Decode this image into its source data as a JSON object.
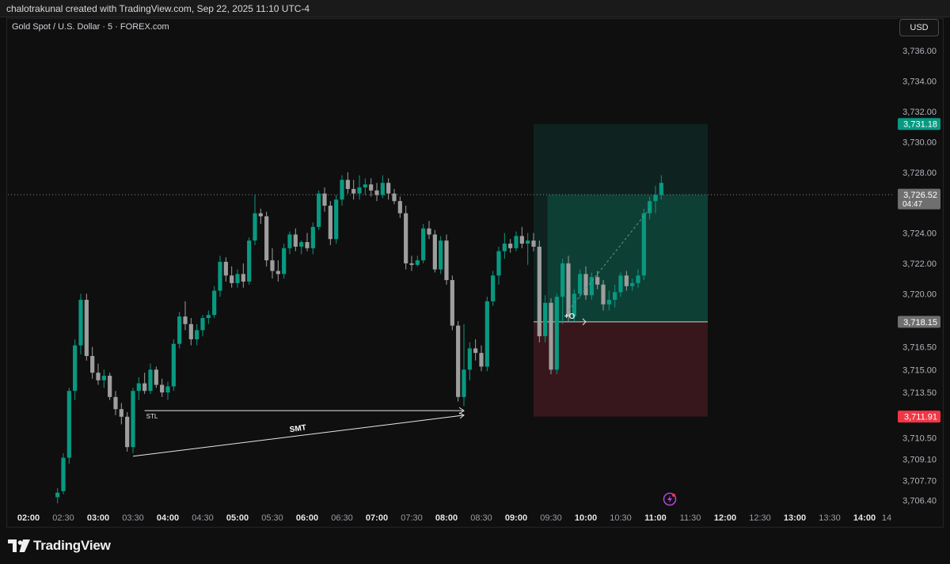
{
  "header": {
    "creator_line": "chalotrakunal created with TradingView.com, Sep 22, 2025 11:10 UTC-4"
  },
  "symbol_line": "Gold Spot / U.S. Dollar · 5 · FOREX.com",
  "currency_button": "USD",
  "brand": "TradingView",
  "colors": {
    "up": "#089981",
    "down": "#9e9e9e",
    "target_zone": "#0f4a3e",
    "stop_zone": "#3a181c",
    "target_label": "#089981",
    "stop_label": "#f23645",
    "current_label": "#6f6f6f"
  },
  "chart_data": {
    "type": "candlestick",
    "interval_minutes": 5,
    "x_tick_labels": [
      "02:00",
      "02:30",
      "03:00",
      "03:30",
      "04:00",
      "04:30",
      "05:00",
      "05:30",
      "06:00",
      "06:30",
      "07:00",
      "07:30",
      "08:00",
      "08:30",
      "09:00",
      "09:30",
      "10:00",
      "10:30",
      "11:00",
      "11:30",
      "12:00",
      "12:30",
      "13:00",
      "13:30",
      "14:00",
      "14"
    ],
    "y_tick_labels": [
      "3,736.00",
      "3,734.00",
      "3,732.00",
      "3,730.00",
      "3,728.00",
      "3,724.00",
      "3,722.00",
      "3,720.00",
      "3,716.50",
      "3,715.00",
      "3,713.50",
      "3,710.50",
      "3,709.10",
      "3,707.70",
      "3,706.40"
    ],
    "y_tick_values": [
      3736.0,
      3734.0,
      3732.0,
      3730.0,
      3728.0,
      3724.0,
      3722.0,
      3720.0,
      3716.5,
      3715.0,
      3713.5,
      3710.5,
      3709.1,
      3707.7,
      3706.4
    ],
    "ylim": [
      3705.9,
      3737.0
    ],
    "ohlc_by_time": [
      [
        "02:25",
        3706.6,
        3707.2,
        3706.2,
        3706.9
      ],
      [
        "02:30",
        3707.0,
        3709.5,
        3706.8,
        3709.2
      ],
      [
        "02:35",
        3709.2,
        3713.8,
        3708.8,
        3713.6
      ],
      [
        "02:40",
        3713.6,
        3717.0,
        3713.0,
        3716.6
      ],
      [
        "02:45",
        3716.6,
        3720.0,
        3716.0,
        3719.6
      ],
      [
        "02:50",
        3719.6,
        3720.0,
        3715.6,
        3715.9
      ],
      [
        "02:55",
        3715.9,
        3716.5,
        3714.4,
        3714.8
      ],
      [
        "03:00",
        3714.8,
        3715.4,
        3714.0,
        3714.3
      ],
      [
        "03:05",
        3714.3,
        3715.0,
        3713.8,
        3714.6
      ],
      [
        "03:10",
        3714.6,
        3714.8,
        3713.0,
        3713.2
      ],
      [
        "03:15",
        3713.2,
        3713.6,
        3712.0,
        3712.4
      ],
      [
        "03:20",
        3712.4,
        3712.8,
        3711.4,
        3711.9
      ],
      [
        "03:25",
        3711.9,
        3712.2,
        3709.6,
        3709.9
      ],
      [
        "03:30",
        3709.9,
        3713.8,
        3709.5,
        3713.6
      ],
      [
        "03:35",
        3713.6,
        3714.5,
        3713.0,
        3714.1
      ],
      [
        "03:40",
        3714.1,
        3714.8,
        3713.4,
        3713.6
      ],
      [
        "03:45",
        3713.6,
        3715.4,
        3713.4,
        3715.0
      ],
      [
        "03:50",
        3715.0,
        3715.2,
        3713.8,
        3714.0
      ],
      [
        "03:55",
        3714.0,
        3714.4,
        3713.2,
        3713.5
      ],
      [
        "04:00",
        3713.5,
        3714.2,
        3713.0,
        3713.9
      ],
      [
        "04:05",
        3713.9,
        3717.0,
        3713.6,
        3716.7
      ],
      [
        "04:10",
        3716.7,
        3718.8,
        3716.4,
        3718.5
      ],
      [
        "04:15",
        3718.5,
        3719.5,
        3717.6,
        3718.0
      ],
      [
        "04:20",
        3718.0,
        3718.4,
        3716.6,
        3717.0
      ],
      [
        "04:25",
        3717.0,
        3718.0,
        3716.6,
        3717.6
      ],
      [
        "04:30",
        3717.6,
        3718.6,
        3717.2,
        3718.4
      ],
      [
        "04:35",
        3718.4,
        3718.9,
        3718.0,
        3718.6
      ],
      [
        "04:40",
        3718.6,
        3720.5,
        3718.4,
        3720.2
      ],
      [
        "04:45",
        3720.2,
        3722.5,
        3719.8,
        3722.1
      ],
      [
        "04:50",
        3722.1,
        3722.4,
        3720.8,
        3721.2
      ],
      [
        "04:55",
        3721.2,
        3721.8,
        3720.4,
        3720.7
      ],
      [
        "05:00",
        3720.7,
        3721.6,
        3720.4,
        3721.3
      ],
      [
        "05:05",
        3721.3,
        3722.0,
        3720.4,
        3720.8
      ],
      [
        "05:10",
        3720.8,
        3723.7,
        3720.6,
        3723.5
      ],
      [
        "05:15",
        3723.5,
        3726.5,
        3723.2,
        3725.3
      ],
      [
        "05:20",
        3725.3,
        3725.6,
        3724.6,
        3725.1
      ],
      [
        "05:25",
        3725.1,
        3725.4,
        3721.8,
        3722.2
      ],
      [
        "05:30",
        3722.2,
        3723.0,
        3721.0,
        3721.5
      ],
      [
        "05:35",
        3721.5,
        3722.2,
        3720.8,
        3721.3
      ],
      [
        "05:40",
        3721.3,
        3723.3,
        3721.0,
        3723.0
      ],
      [
        "05:45",
        3723.0,
        3724.1,
        3722.6,
        3723.9
      ],
      [
        "05:50",
        3723.9,
        3724.3,
        3722.8,
        3723.1
      ],
      [
        "05:55",
        3723.1,
        3723.5,
        3722.6,
        3723.4
      ],
      [
        "06:00",
        3723.4,
        3724.0,
        3722.8,
        3723.0
      ],
      [
        "06:05",
        3723.0,
        3724.7,
        3722.6,
        3724.4
      ],
      [
        "06:10",
        3724.4,
        3726.8,
        3724.2,
        3726.6
      ],
      [
        "06:15",
        3726.6,
        3727.0,
        3725.4,
        3725.8
      ],
      [
        "06:20",
        3725.8,
        3726.1,
        3723.2,
        3723.6
      ],
      [
        "06:25",
        3723.6,
        3726.5,
        3723.3,
        3726.2
      ],
      [
        "06:30",
        3726.2,
        3727.8,
        3725.8,
        3727.5
      ],
      [
        "06:35",
        3727.5,
        3728.0,
        3726.6,
        3726.9
      ],
      [
        "06:40",
        3726.9,
        3727.5,
        3726.2,
        3726.6
      ],
      [
        "06:45",
        3726.6,
        3727.8,
        3726.2,
        3727.0
      ],
      [
        "06:50",
        3727.0,
        3727.6,
        3726.5,
        3727.2
      ],
      [
        "06:55",
        3727.2,
        3727.6,
        3726.4,
        3726.8
      ],
      [
        "07:00",
        3726.8,
        3727.3,
        3726.1,
        3726.5
      ],
      [
        "07:05",
        3726.5,
        3727.8,
        3726.3,
        3727.3
      ],
      [
        "07:10",
        3727.3,
        3727.6,
        3726.2,
        3726.6
      ],
      [
        "07:15",
        3726.6,
        3726.9,
        3725.9,
        3726.1
      ],
      [
        "07:20",
        3726.1,
        3726.4,
        3725.0,
        3725.3
      ],
      [
        "07:25",
        3725.3,
        3725.8,
        3721.6,
        3722.0
      ],
      [
        "07:30",
        3722.0,
        3722.5,
        3721.5,
        3721.9
      ],
      [
        "07:35",
        3721.9,
        3722.5,
        3721.8,
        3722.2
      ],
      [
        "07:40",
        3722.2,
        3724.6,
        3722.0,
        3724.3
      ],
      [
        "07:45",
        3724.3,
        3724.8,
        3723.6,
        3723.9
      ],
      [
        "07:50",
        3723.9,
        3724.2,
        3721.4,
        3721.6
      ],
      [
        "07:55",
        3721.6,
        3723.8,
        3721.3,
        3723.5
      ],
      [
        "08:00",
        3723.5,
        3723.9,
        3720.6,
        3720.9
      ],
      [
        "08:05",
        3720.9,
        3721.2,
        3717.6,
        3717.9
      ],
      [
        "08:10",
        3717.9,
        3718.2,
        3712.9,
        3713.2
      ],
      [
        "08:15",
        3713.2,
        3718.0,
        3712.6,
        3715.0
      ],
      [
        "08:20",
        3715.0,
        3716.8,
        3714.3,
        3716.4
      ],
      [
        "08:25",
        3716.4,
        3717.0,
        3715.6,
        3716.1
      ],
      [
        "08:30",
        3716.1,
        3716.6,
        3714.9,
        3715.2
      ],
      [
        "08:35",
        3715.2,
        3719.8,
        3714.9,
        3719.5
      ],
      [
        "08:40",
        3719.5,
        3721.5,
        3719.2,
        3721.2
      ],
      [
        "08:45",
        3721.2,
        3723.1,
        3720.6,
        3722.8
      ],
      [
        "08:50",
        3722.8,
        3724.0,
        3722.3,
        3723.3
      ],
      [
        "08:55",
        3723.3,
        3723.6,
        3722.7,
        3723.0
      ],
      [
        "09:00",
        3723.0,
        3724.1,
        3722.8,
        3723.8
      ],
      [
        "09:05",
        3723.8,
        3724.4,
        3723.0,
        3723.3
      ],
      [
        "09:10",
        3723.3,
        3724.0,
        3721.9,
        3723.5
      ],
      [
        "09:15",
        3723.5,
        3724.0,
        3722.8,
        3723.1
      ],
      [
        "09:20",
        3723.1,
        3723.5,
        3716.8,
        3717.2
      ],
      [
        "09:25",
        3717.2,
        3719.9,
        3716.8,
        3719.4
      ],
      [
        "09:30",
        3719.4,
        3719.7,
        3714.7,
        3715.0
      ],
      [
        "09:35",
        3715.0,
        3720.0,
        3714.7,
        3719.8
      ],
      [
        "09:40",
        3719.8,
        3722.3,
        3718.0,
        3722.0
      ],
      [
        "09:45",
        3722.0,
        3722.5,
        3718.2,
        3718.5
      ],
      [
        "09:50",
        3718.5,
        3720.3,
        3718.2,
        3720.0
      ],
      [
        "09:55",
        3720.0,
        3721.6,
        3719.7,
        3721.3
      ],
      [
        "10:00",
        3721.3,
        3721.8,
        3719.6,
        3719.9
      ],
      [
        "10:05",
        3719.9,
        3721.4,
        3719.6,
        3721.1
      ],
      [
        "10:10",
        3721.1,
        3721.5,
        3720.3,
        3720.6
      ],
      [
        "10:15",
        3720.6,
        3720.9,
        3718.9,
        3719.3
      ],
      [
        "10:20",
        3719.3,
        3720.2,
        3718.9,
        3719.6
      ],
      [
        "10:25",
        3719.6,
        3720.6,
        3719.1,
        3720.1
      ],
      [
        "10:30",
        3720.1,
        3721.4,
        3719.8,
        3721.2
      ],
      [
        "10:35",
        3721.2,
        3721.5,
        3720.2,
        3720.5
      ],
      [
        "10:40",
        3720.5,
        3721.0,
        3720.2,
        3720.7
      ],
      [
        "10:45",
        3720.7,
        3721.6,
        3720.4,
        3721.2
      ],
      [
        "10:50",
        3721.2,
        3725.6,
        3720.9,
        3725.3
      ],
      [
        "10:55",
        3725.3,
        3726.4,
        3724.9,
        3726.1
      ],
      [
        "11:00",
        3726.1,
        3727.1,
        3725.3,
        3726.5
      ],
      [
        "11:05",
        3726.5,
        3727.8,
        3726.2,
        3727.3
      ]
    ],
    "price_labels": {
      "target": "3,731.18",
      "current": "3,726.52",
      "countdown": "04:47",
      "entry": "3,718.15",
      "stop": "3,711.91"
    },
    "levels": {
      "target": 3731.18,
      "current": 3726.52,
      "entry": 3718.15,
      "stop": 3711.91
    },
    "annotations": {
      "stl_label": "STL",
      "smt_label": "SMT",
      "entry_marker": "+O"
    }
  }
}
